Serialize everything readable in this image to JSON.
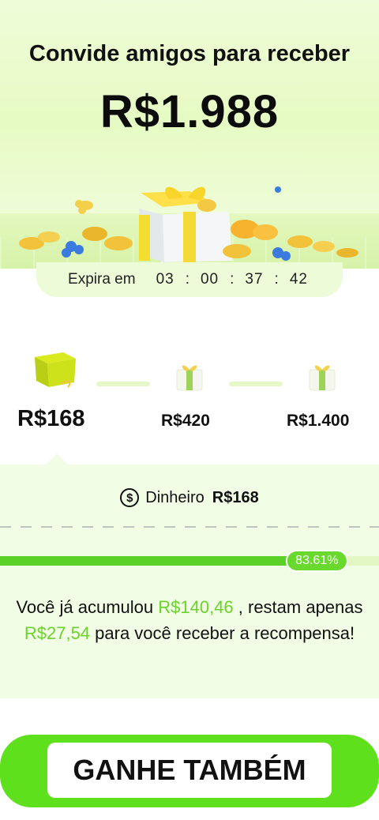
{
  "header": {
    "title": "Convide amigos para receber",
    "amount": "R$1.988"
  },
  "timer": {
    "label": "Expira em",
    "hours": "03",
    "minutes": "00",
    "seconds": "37",
    "centis": "42"
  },
  "steps": [
    {
      "amount": "R$168",
      "active": true
    },
    {
      "amount": "R$420",
      "active": false
    },
    {
      "amount": "R$1.400",
      "active": false
    }
  ],
  "reward": {
    "icon": "dollar-coin-icon",
    "label": "Dinheiro",
    "value": "R$168"
  },
  "progress": {
    "percent": 83.61,
    "label": "83.61%"
  },
  "message": {
    "part1": "Você já acumulou ",
    "accumulated": "R$140,46",
    "part2": " , restam apenas ",
    "remaining": "R$27,54",
    "part3": " para você receber a recompensa!"
  },
  "cta": {
    "label": "GANHE TAMBÉM"
  },
  "colors": {
    "accent": "#5bd128",
    "highlight_text": "#6bd32b",
    "cta": "#5fe01d"
  }
}
